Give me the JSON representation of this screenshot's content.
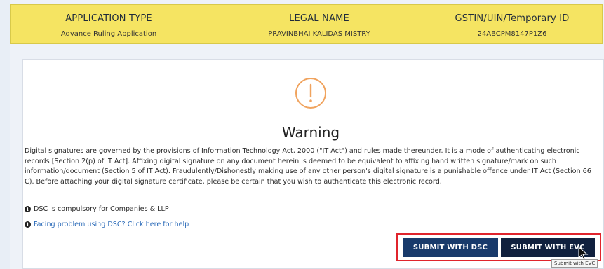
{
  "header": {
    "application_type_label": "APPLICATION TYPE",
    "application_type_value": "Advance Ruling Application",
    "legal_name_label": "LEGAL NAME",
    "legal_name_value": "PRAVINBHAI KALIDAS MISTRY",
    "gstin_label": "GSTIN/UIN/Temporary ID",
    "gstin_value": "24ABCPM8147P1Z6"
  },
  "modal": {
    "icon": "exclamation-circle-icon",
    "title": "Warning",
    "body": "Digital signatures are governed by the provisions of Information Technology Act, 2000 (\"IT Act\") and rules made thereunder. It is a mode of authenticating electronic records [Section 2(p) of IT Act]. Affixing digital signature on any document herein is deemed to be equivalent to affixing hand written signature/mark on such information/document (Section 5 of IT Act). Fraudulently/Dishonestly making use of any other person's digital signature is a punishable offence under IT Act (Section 66 C). Before attaching your digital signature certificate, please be certain that you wish to authenticate this electronic record.",
    "note_dsc": "DSC is compulsory for Companies & LLP",
    "help_link": "Facing problem using DSC? Click here for help",
    "submit_dsc_label": "SUBMIT WITH DSC",
    "submit_evc_label": "SUBMIT WITH EVC",
    "tooltip": "Submit with EVC"
  },
  "colors": {
    "header_bg": "#f5e462",
    "warning_icon": "#f0a35e",
    "button_bg": "#183a6b",
    "highlight": "#e0242c",
    "link": "#2a6ab8"
  }
}
